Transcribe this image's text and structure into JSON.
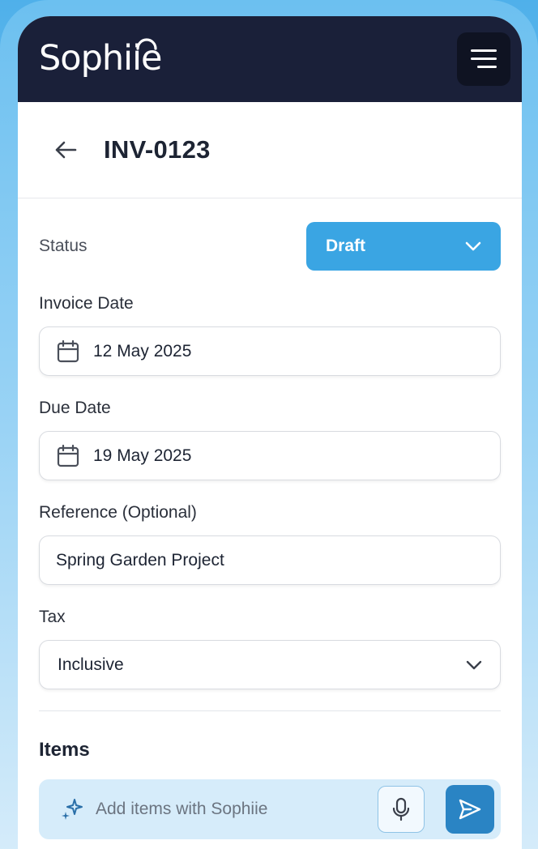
{
  "app": {
    "logo_text": "Sophiie"
  },
  "header": {
    "menu_icon": "hamburger-menu-icon"
  },
  "page": {
    "title": "INV-0123",
    "back_icon": "arrow-left-icon"
  },
  "form": {
    "status": {
      "label": "Status",
      "value": "Draft"
    },
    "invoice_date": {
      "label": "Invoice Date",
      "value": "12 May 2025"
    },
    "due_date": {
      "label": "Due Date",
      "value": "19 May 2025"
    },
    "reference": {
      "label": "Reference (Optional)",
      "value": "Spring Garden Project"
    },
    "tax": {
      "label": "Tax",
      "value": "Inclusive"
    }
  },
  "items": {
    "heading": "Items",
    "ai_input": {
      "placeholder": "Add items with Sophiie"
    }
  },
  "colors": {
    "navbar": "#1a2039",
    "accent": "#3aa5e3",
    "send_button": "#2a84c4",
    "ai_bar": "#d6ecfa"
  }
}
